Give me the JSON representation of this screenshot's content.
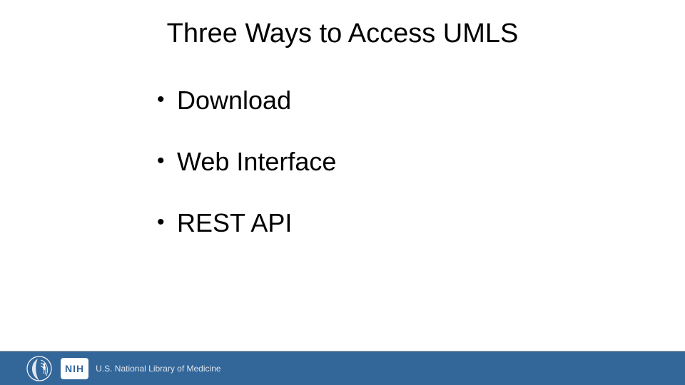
{
  "title": "Three Ways to Access UMLS",
  "bullets": [
    "Download",
    "Web Interface",
    "REST API"
  ],
  "footer": {
    "nih_badge": "NIH",
    "nlm_text": "U.S. National Library of Medicine"
  }
}
